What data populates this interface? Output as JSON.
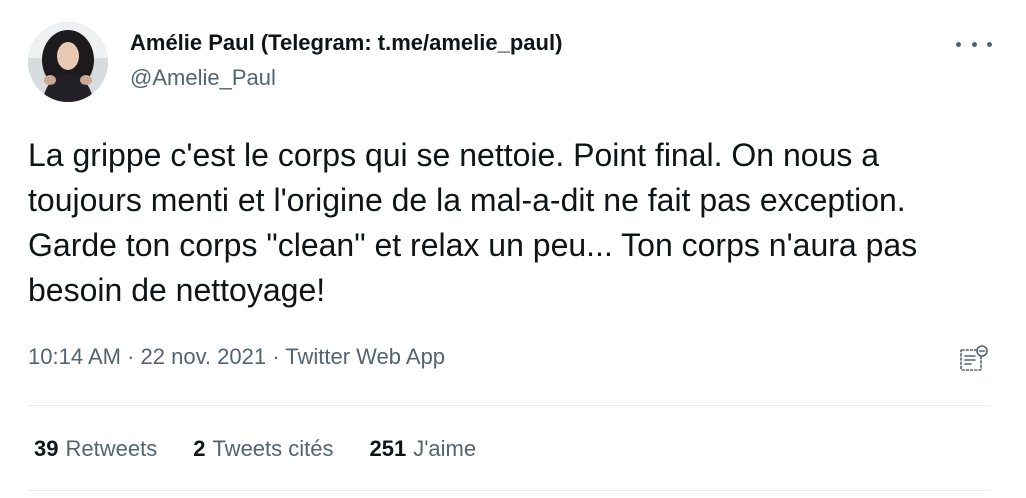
{
  "author": {
    "display_name": "Amélie Paul (Telegram: t.me/amelie_paul)",
    "handle": "@Amelie_Paul"
  },
  "tweet": {
    "text": "La grippe c'est le corps qui se nettoie. Point final. On nous a toujours menti et l'origine de la mal-a-dit ne fait pas exception. Garde ton corps \"clean\" et relax un peu... Ton corps n'aura pas besoin de nettoyage!",
    "time": "10:14 AM",
    "date": "22 nov. 2021",
    "source": "Twitter Web App",
    "separator": " · "
  },
  "stats": {
    "retweets": {
      "count": "39",
      "label": "Retweets"
    },
    "quotes": {
      "count": "2",
      "label": "Tweets cités"
    },
    "likes": {
      "count": "251",
      "label": "J'aime"
    }
  },
  "icons": {
    "more": "more-horizontal-icon",
    "analytics": "analytics-icon"
  },
  "colors": {
    "text_primary": "#0f1419",
    "text_secondary": "#536471",
    "divider": "#e6ecf0"
  }
}
